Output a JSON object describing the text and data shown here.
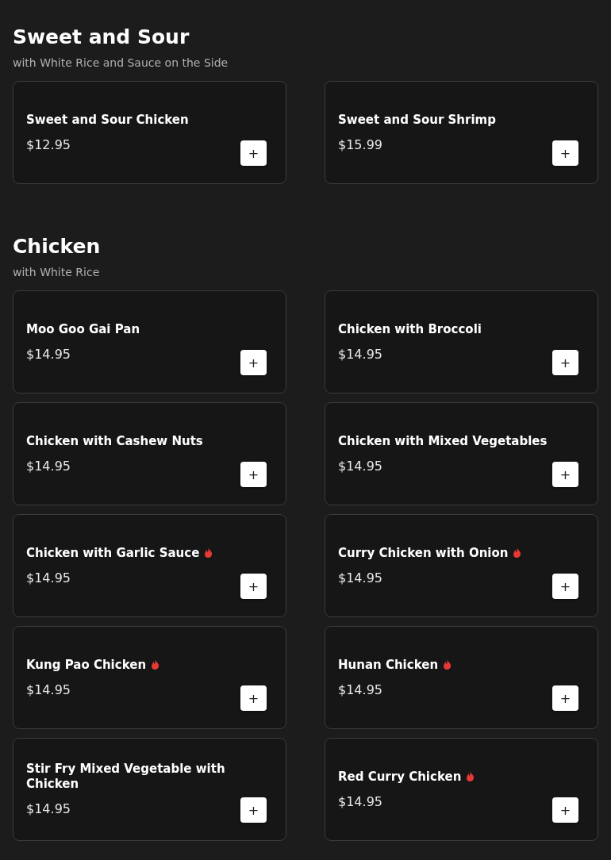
{
  "sections": [
    {
      "title": "Sweet and Sour",
      "subtitle": "with White Rice and Sauce on the Side",
      "items": [
        {
          "name": "Sweet and Sour Chicken",
          "price": "$12.95",
          "spicy": false,
          "button": "+"
        },
        {
          "name": "Sweet and Sour Shrimp",
          "price": "$15.99",
          "spicy": false,
          "button": "+"
        }
      ]
    },
    {
      "title": "Chicken",
      "subtitle": "with White Rice",
      "items": [
        {
          "name": "Moo Goo Gai Pan",
          "price": "$14.95",
          "spicy": false,
          "button": "+"
        },
        {
          "name": "Chicken with Broccoli",
          "price": "$14.95",
          "spicy": false,
          "button": "+"
        },
        {
          "name": "Chicken with Cashew Nuts",
          "price": "$14.95",
          "spicy": false,
          "button": "+"
        },
        {
          "name": "Chicken with Mixed Vegetables",
          "price": "$14.95",
          "spicy": false,
          "button": "+"
        },
        {
          "name": "Chicken with Garlic Sauce",
          "price": "$14.95",
          "spicy": true,
          "button": "+"
        },
        {
          "name": "Curry Chicken with Onion",
          "price": "$14.95",
          "spicy": true,
          "button": "+"
        },
        {
          "name": "Kung Pao Chicken",
          "price": "$14.95",
          "spicy": true,
          "button": "+"
        },
        {
          "name": "Hunan Chicken",
          "price": "$14.95",
          "spicy": true,
          "button": "+"
        },
        {
          "name": "Stir Fry Mixed Vegetable with Chicken",
          "price": "$14.95",
          "spicy": false,
          "button": "+"
        },
        {
          "name": "Red Curry Chicken",
          "price": "$14.95",
          "spicy": true,
          "button": "+"
        }
      ]
    }
  ]
}
